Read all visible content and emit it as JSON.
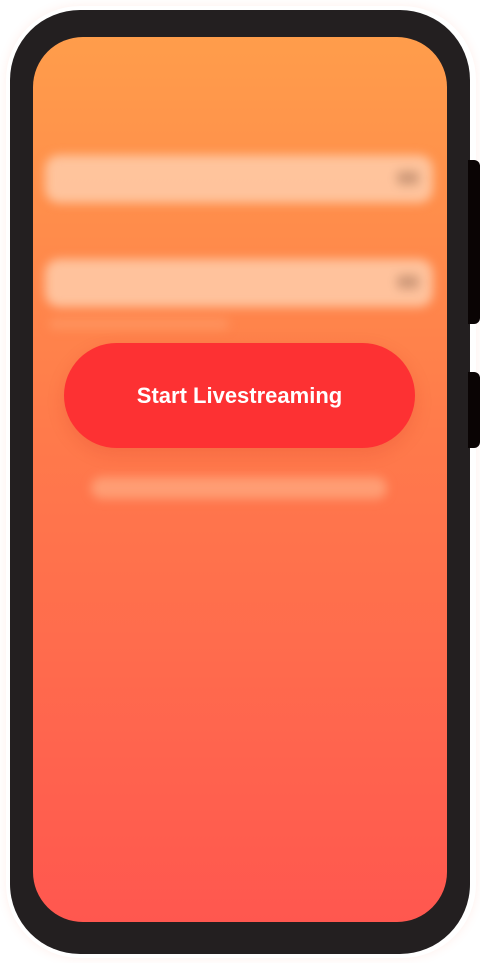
{
  "screen": {
    "title": "",
    "start_button_label": "Start Livestreaming"
  },
  "form": {
    "fields": [
      {
        "label": "",
        "value": ""
      },
      {
        "label": "",
        "value": ""
      }
    ]
  },
  "colors": {
    "frame": "#231f20",
    "gradient_top": "#ff9d4b",
    "gradient_bottom": "#ff574f",
    "primary_button": "#fd3133",
    "button_text": "#ffffff"
  }
}
